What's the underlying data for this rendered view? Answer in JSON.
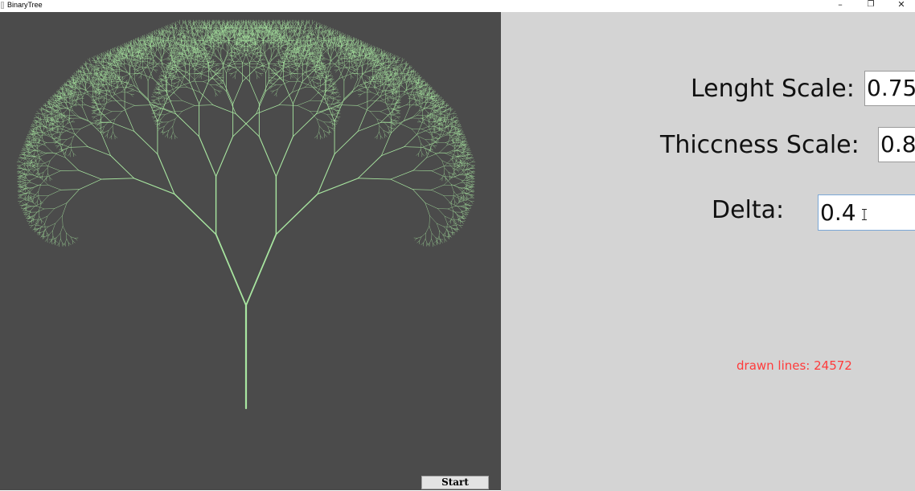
{
  "window": {
    "title": "BinaryTree",
    "minimize_glyph": "–",
    "maximize_glyph": "❐",
    "close_glyph": "✕"
  },
  "canvas": {
    "background": "#4b4b4b",
    "branch_color": "#a8e6a0",
    "tree_depth": 12
  },
  "controls": {
    "length_scale_label": "Lenght Scale:",
    "length_scale_value": "0.75",
    "thickness_scale_label": "Thiccness Scale:",
    "thickness_scale_value": "0.8",
    "delta_label": "Delta:",
    "delta_value": "0.4",
    "start_label": "Start"
  },
  "status": {
    "text": "drawn lines: 24572",
    "color": "#ff3b3b"
  },
  "icons": {
    "text_cursor": "text-cursor-icon",
    "app": "app-icon"
  }
}
